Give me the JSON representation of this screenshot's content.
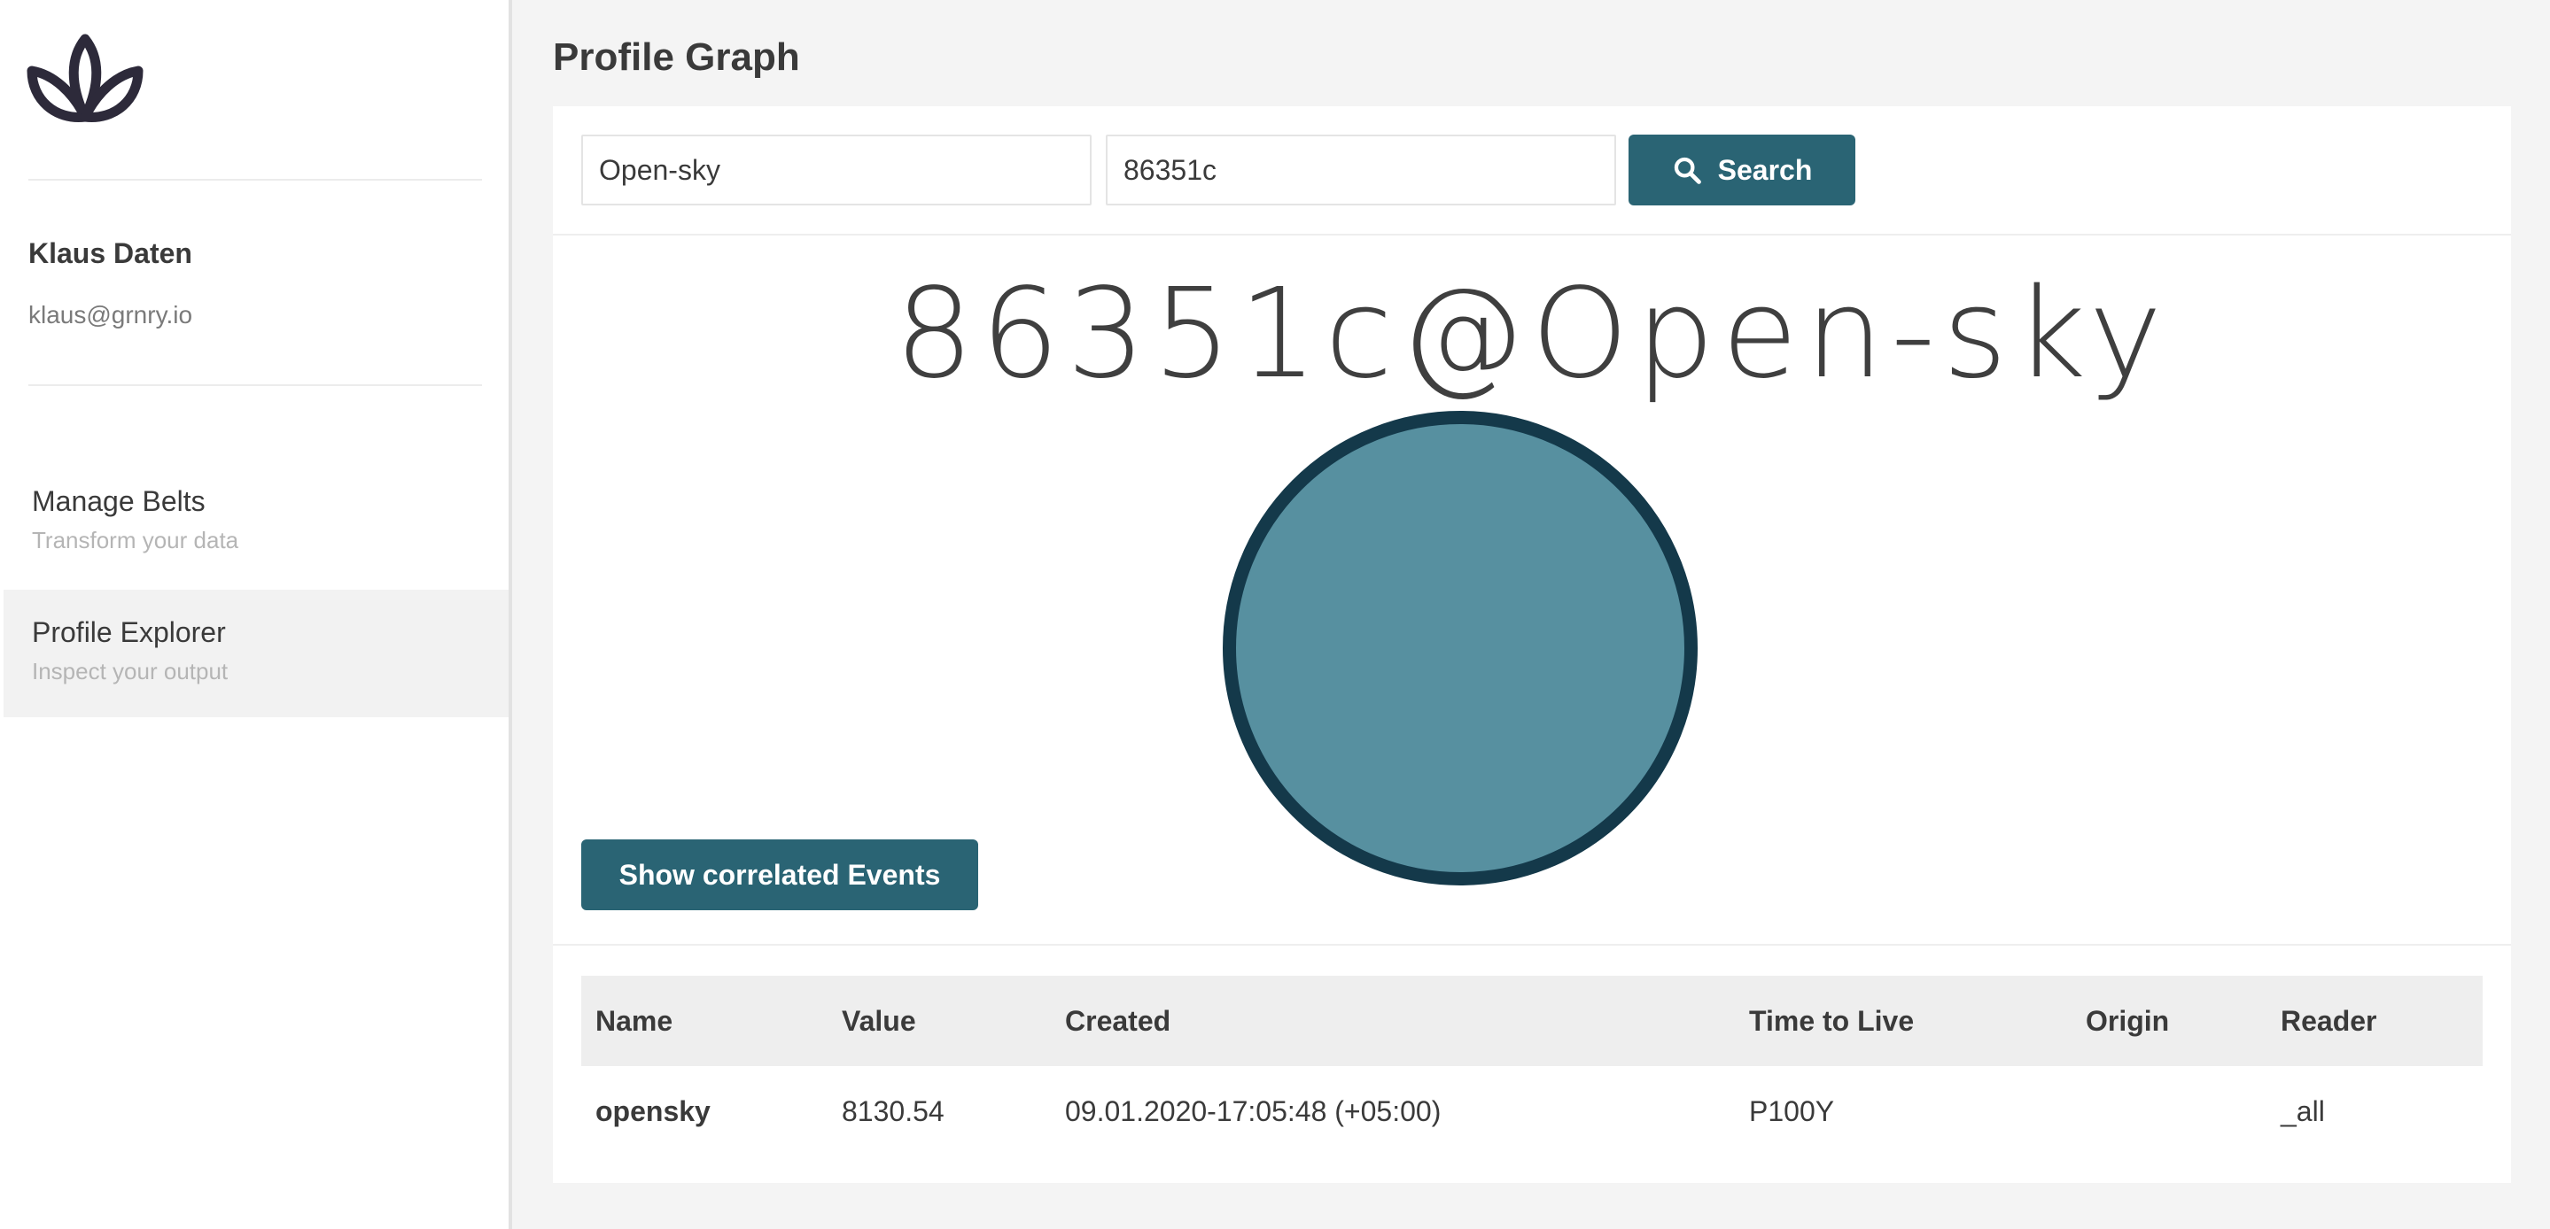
{
  "sidebar": {
    "user": {
      "name": "Klaus Daten",
      "email": "klaus@grnry.io"
    },
    "nav": [
      {
        "title": "Manage Belts",
        "subtitle": "Transform your data",
        "active": false
      },
      {
        "title": "Profile Explorer",
        "subtitle": "Inspect your output",
        "active": true
      }
    ]
  },
  "main": {
    "title": "Profile Graph",
    "search": {
      "source_value": "Open-sky",
      "id_value": "86351c",
      "button_label": "Search"
    },
    "profile_heading": "86351c@Open-sky",
    "correlated_button": "Show correlated Events",
    "table": {
      "columns": [
        "Name",
        "Value",
        "Created",
        "Time to Live",
        "Origin",
        "Reader"
      ],
      "rows": [
        [
          "opensky",
          "8130.54",
          "09.01.2020-17:05:48 (+05:00)",
          "P100Y",
          "",
          "_all"
        ]
      ]
    }
  },
  "colors": {
    "accent": "#2a6474",
    "node_fill": "#5790a0",
    "node_border": "#14394a",
    "logo": "#2d2a3a"
  },
  "icons": {
    "logo": "lotus-logo-icon",
    "search": "search-icon"
  }
}
